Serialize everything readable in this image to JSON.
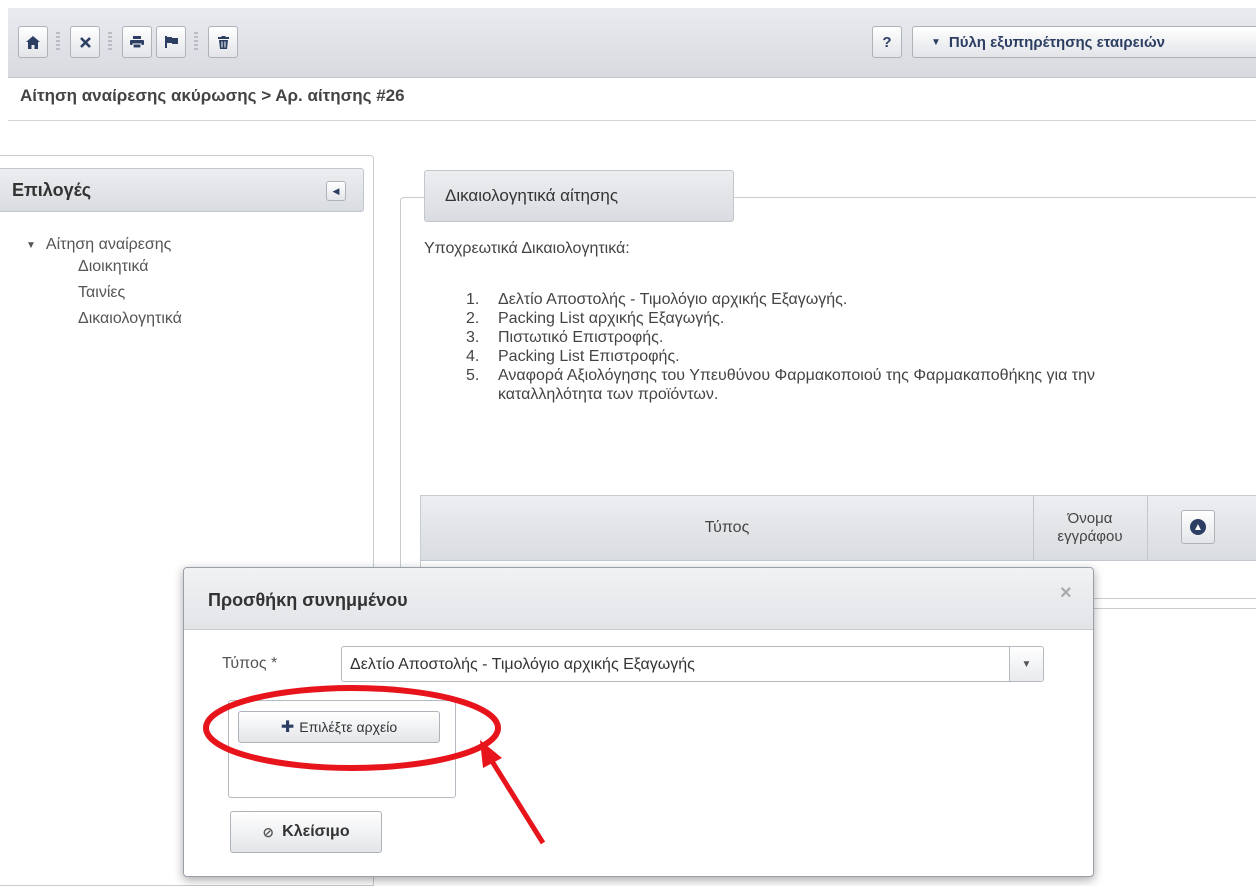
{
  "toolbar": {
    "help_label": "?",
    "portal_label": "Πύλη εξυπηρέτησης εταιρειών"
  },
  "breadcrumb": "Αίτηση αναίρεσης ακύρωσης > Αρ. αίτησης #26",
  "sidebar": {
    "title": "Επιλογές",
    "tree": {
      "parent": "Αίτηση αναίρεσης",
      "children": [
        "Διοικητικά",
        "Ταινίες",
        "Δικαιολογητικά"
      ]
    }
  },
  "main": {
    "legend": "Δικαιολογητικά αίτησης",
    "required_title": "Υποχρεωτικά Δικαιολογητικά:",
    "required_items": [
      {
        "num": "1.",
        "text": "Δελτίο Αποστολής - Τιμολόγιο αρχικής Εξαγωγής."
      },
      {
        "num": "2.",
        "text": "Packing List αρχικής Εξαγωγής."
      },
      {
        "num": "3.",
        "text": "Πιστωτικό Επιστροφής."
      },
      {
        "num": "4.",
        "text": "Packing List Επιστροφής."
      },
      {
        "num": "5.",
        "text": "Αναφορά Αξιολόγησης του Υπευθύνου Φαρμακοποιού της Φαρμακαποθήκης για την καταλληλότητα των προϊόντων."
      }
    ],
    "table": {
      "col_type": "Τύπος",
      "col_name": "Όνομα εγγράφου"
    }
  },
  "modal": {
    "title": "Προσθήκη συνημμένου",
    "close_icon": "×",
    "type_label": "Τύπος *",
    "type_value": "Δελτίο Αποστολής - Τιμολόγιο αρχικής Εξαγωγής",
    "choose_file_label": "Επιλέξτε αρχείο",
    "close_label": "Κλείσιμο"
  },
  "annotation": {
    "color": "#e8141c"
  }
}
